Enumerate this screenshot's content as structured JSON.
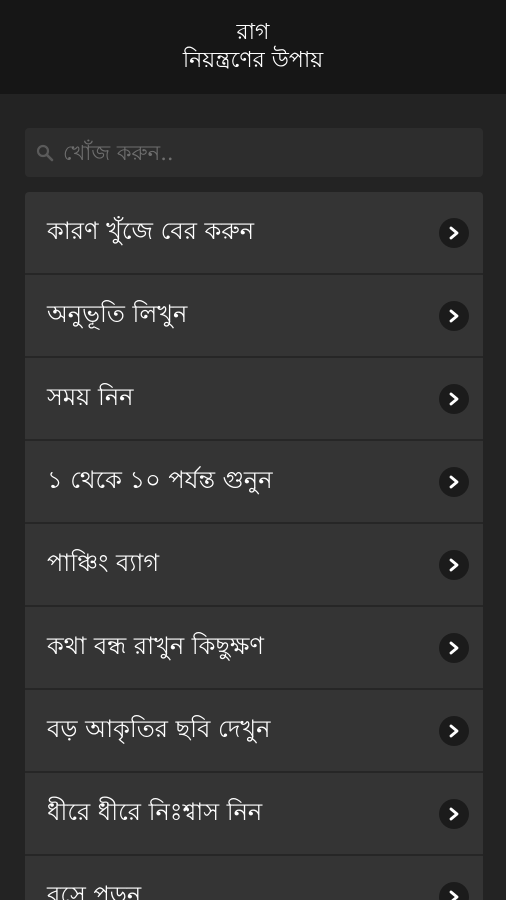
{
  "header": {
    "title_line1": "রাগ",
    "title_line2": "নিয়ন্ত্রণের উপায়"
  },
  "search": {
    "placeholder": "খোঁজ করুন..",
    "value": "",
    "icon": "search-icon"
  },
  "items": [
    {
      "label": "কারণ খুঁজে বের করুন",
      "icon": "chevron-right-icon"
    },
    {
      "label": "অনুভূতি লিখুন",
      "icon": "chevron-right-icon"
    },
    {
      "label": "সময় নিন",
      "icon": "chevron-right-icon"
    },
    {
      "label": "১ থেকে ১০ পর্যন্ত গুনুন",
      "icon": "chevron-right-icon"
    },
    {
      "label": "পাঞ্চিং ব্যাগ",
      "icon": "chevron-right-icon"
    },
    {
      "label": "কথা বন্ধ রাখুন কিছুক্ষণ",
      "icon": "chevron-right-icon"
    },
    {
      "label": "বড় আকৃতির ছবি দেখুন",
      "icon": "chevron-right-icon"
    },
    {
      "label": "ধীরে ধীরে নিঃশ্বাস নিন",
      "icon": "chevron-right-icon"
    },
    {
      "label": "বসে পড়ুন",
      "icon": "chevron-right-icon"
    }
  ],
  "colors": {
    "background": "#232323",
    "header_bg": "#161616",
    "item_bg": "#343434",
    "text": "#ffffff"
  }
}
